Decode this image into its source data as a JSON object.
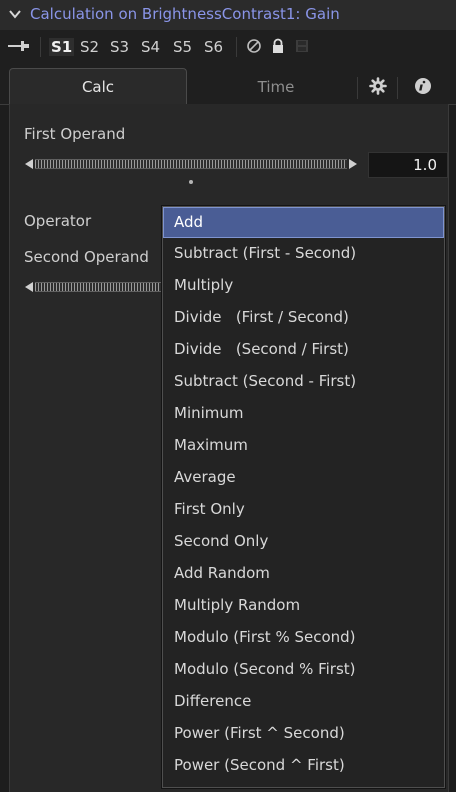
{
  "header": {
    "title": "Calculation on BrightnessContrast1: Gain",
    "collapse_icon": "chevron-down-icon"
  },
  "versions": {
    "items": [
      "S1",
      "S2",
      "S3",
      "S4",
      "S5",
      "S6"
    ],
    "active": "S1",
    "icons": [
      "pin-icon",
      "reset-icon",
      "lock-icon",
      "save-icon"
    ]
  },
  "tabs": {
    "calc": "Calc",
    "time": "Time",
    "icons": [
      "gear-icon",
      "info-icon"
    ]
  },
  "first_operand": {
    "label": "First Operand",
    "value": "1.0"
  },
  "operator": {
    "label": "Operator",
    "selected": "Add",
    "options": [
      "Add",
      "Subtract (First - Second)",
      "Multiply",
      "Divide   (First / Second)",
      "Divide   (Second / First)",
      "Subtract (Second - First)",
      "Minimum",
      "Maximum",
      "Average",
      "First Only",
      "Second Only",
      "Add Random",
      "Multiply Random",
      "Modulo (First % Second)",
      "Modulo (Second % First)",
      "Difference",
      "Power (First ^ Second)",
      "Power (Second ^ First)"
    ]
  },
  "second_operand": {
    "label": "Second Operand"
  },
  "colors": {
    "title": "#8a95e8",
    "selection": "#4a5d95",
    "background": "#282828"
  }
}
